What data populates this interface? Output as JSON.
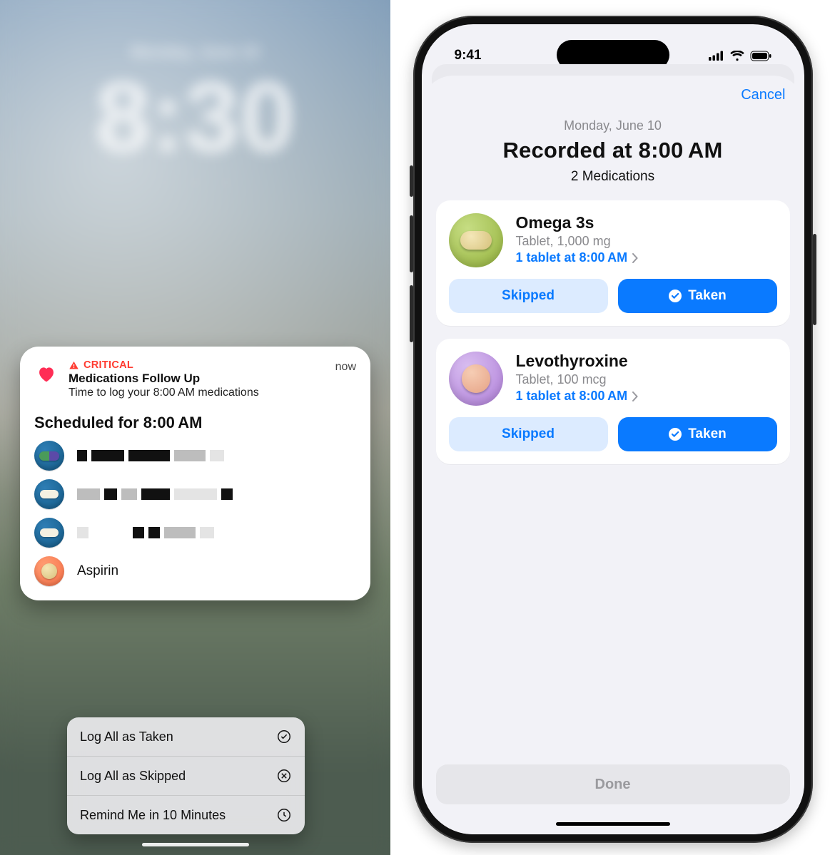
{
  "left": {
    "lock": {
      "date": "Monday, June 10",
      "time": "8:30"
    },
    "notification": {
      "critical_label": "CRITICAL",
      "title": "Medications Follow Up",
      "body": "Time to log your 8:00 AM medications",
      "timestamp": "now",
      "scheduled_heading": "Scheduled for 8:00 AM",
      "meds": [
        {
          "icon": "capsule",
          "label": null
        },
        {
          "icon": "pill",
          "label": null
        },
        {
          "icon": "pill",
          "label": null
        },
        {
          "icon": "disc",
          "label": "Aspirin"
        }
      ]
    },
    "actions": {
      "taken": "Log All as Taken",
      "skipped": "Log All as Skipped",
      "remind": "Remind Me in 10 Minutes"
    }
  },
  "right": {
    "status_time": "9:41",
    "cancel": "Cancel",
    "header": {
      "date": "Monday, June 10",
      "title": "Recorded at 8:00 AM",
      "subtitle": "2 Medications"
    },
    "meds": [
      {
        "name": "Omega 3s",
        "desc": "Tablet, 1,000 mg",
        "dose": "1 tablet at 8:00 AM",
        "icon": "green-oval",
        "skipped_label": "Skipped",
        "taken_label": "Taken"
      },
      {
        "name": "Levothyroxine",
        "desc": "Tablet, 100 mcg",
        "dose": "1 tablet at 8:00 AM",
        "icon": "purple-round",
        "skipped_label": "Skipped",
        "taken_label": "Taken"
      }
    ],
    "done": "Done"
  }
}
